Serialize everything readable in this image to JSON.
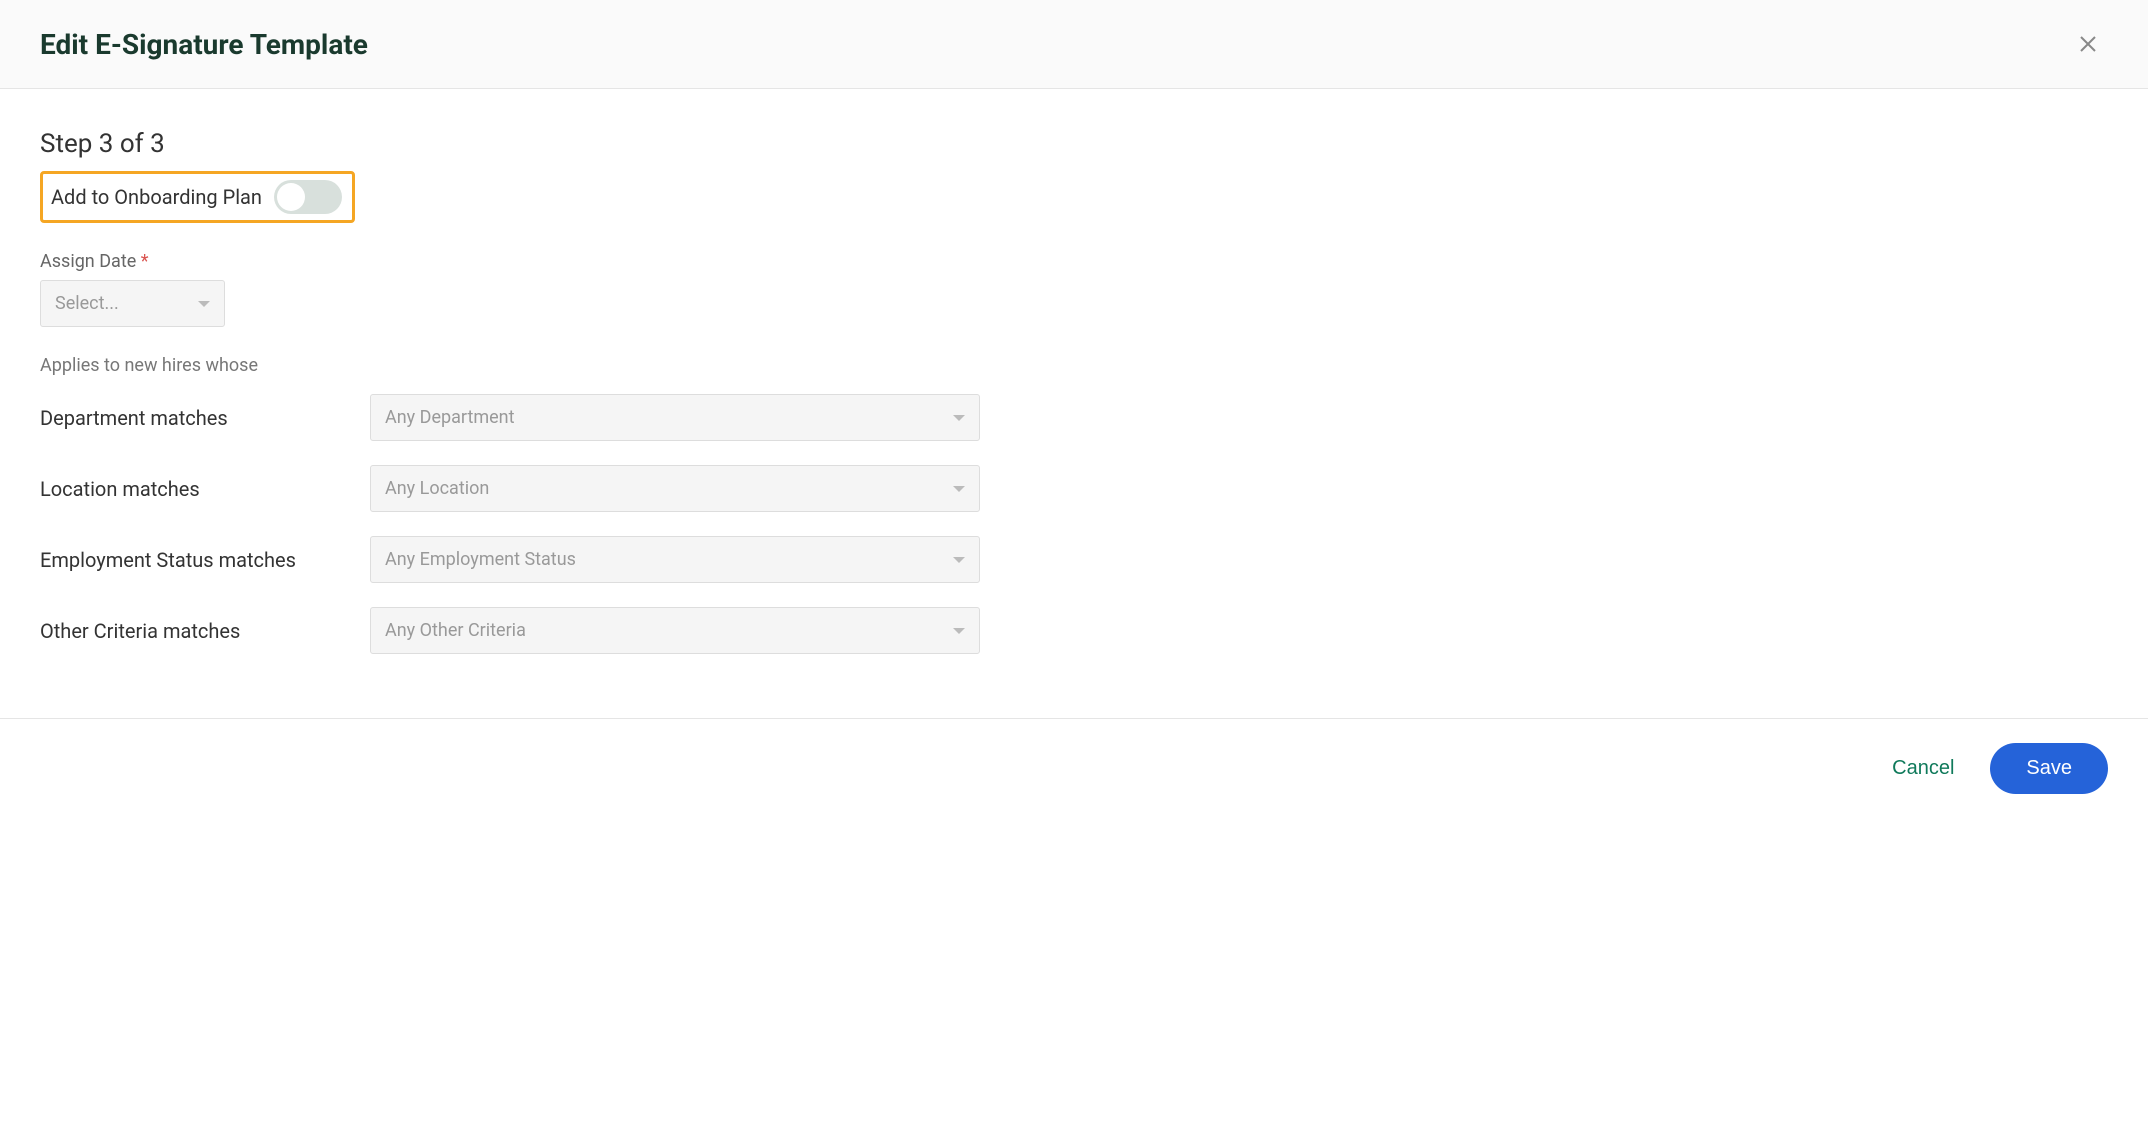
{
  "header": {
    "title": "Edit E-Signature Template"
  },
  "step": {
    "label": "Step 3 of 3"
  },
  "toggle": {
    "label": "Add to Onboarding Plan",
    "state": "off"
  },
  "assign_date": {
    "label": "Assign Date",
    "required_mark": "*",
    "placeholder": "Select..."
  },
  "helper_text": "Applies to new hires whose",
  "criteria": [
    {
      "label": "Department matches",
      "placeholder": "Any Department"
    },
    {
      "label": "Location matches",
      "placeholder": "Any Location"
    },
    {
      "label": "Employment Status matches",
      "placeholder": "Any Employment Status"
    },
    {
      "label": "Other Criteria matches",
      "placeholder": "Any Other Criteria"
    }
  ],
  "footer": {
    "cancel_label": "Cancel",
    "save_label": "Save"
  }
}
